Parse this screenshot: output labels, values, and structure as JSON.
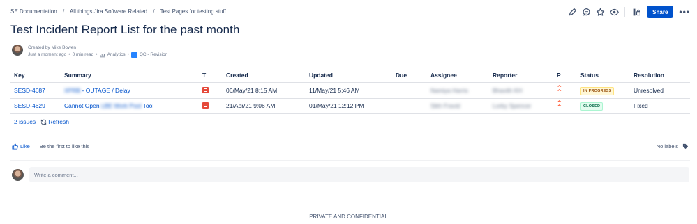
{
  "breadcrumb": [
    "SE Documentation",
    "All things Jira Software Related",
    "Test Pages for testing stuff"
  ],
  "breadcrumb_separator": "/",
  "toolbar": {
    "share_label": "Share",
    "more_label": "•••",
    "icons": [
      "edit-icon",
      "comment-icon",
      "star-icon",
      "watch-icon",
      "restrictions-icon"
    ]
  },
  "page": {
    "title": "Test Incident Report List for the past month"
  },
  "byline": {
    "created_by": "Created by Mike Bowen",
    "timestamp": "Just a moment ago",
    "read_time": "0 min read",
    "analytics": "Analytics",
    "qc": "QC - Revision"
  },
  "table": {
    "headers": [
      "Key",
      "Summary",
      "T",
      "Created",
      "Updated",
      "Due",
      "Assignee",
      "Reporter",
      "P",
      "Status",
      "Resolution"
    ],
    "rows": [
      {
        "key": "SESD-4687",
        "summary_redacted": "XPRB",
        "summary": " - OUTAGE / Delay",
        "created": "06/May/21 8:15 AM",
        "updated": "11/May/21 5:46 AM",
        "due": "",
        "assignee": "Namiya Harris",
        "reporter": "Bhavith KH",
        "status": "IN PROGRESS",
        "resolution": "Unresolved"
      },
      {
        "key": "SESD-4629",
        "summary_prefix": "Cannot Open ",
        "summary_redacted": "LBE Work Pool",
        "summary_suffix": " Tool",
        "created": "21/Apr/21 9:06 AM",
        "updated": "01/May/21 12:12 PM",
        "due": "",
        "assignee": "Sikh Fravid",
        "reporter": "Lorby Spencer",
        "status": "CLOSED",
        "resolution": "Fixed"
      }
    ]
  },
  "issues_footer": {
    "count": "2 issues",
    "refresh": "Refresh"
  },
  "likes": {
    "like_label": "Like",
    "hint": "Be the first to like this",
    "labels_text": "No labels"
  },
  "comment": {
    "placeholder": "Write a comment..."
  },
  "footer_text": "PRIVATE AND CONFIDENTIAL",
  "colors": {
    "brand": "#0052cc",
    "priority": "#ff5630",
    "bug": "#e5493a"
  }
}
